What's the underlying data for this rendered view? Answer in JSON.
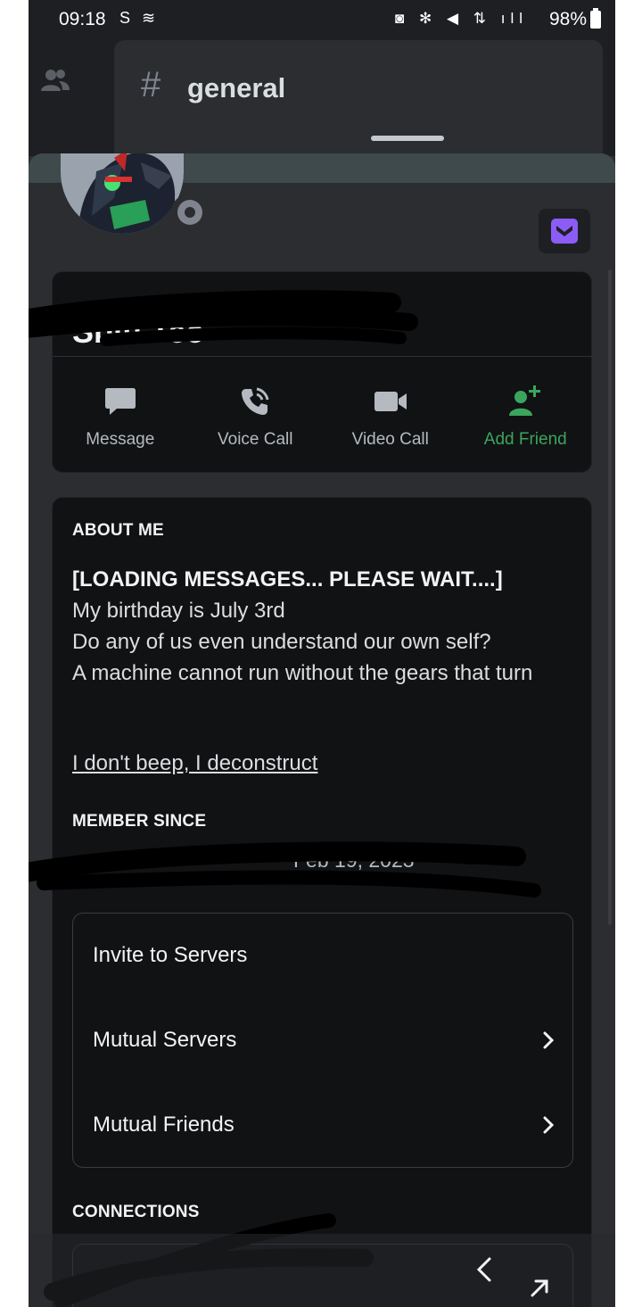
{
  "status_bar": {
    "time": "09:18",
    "left_icons": "S ≋",
    "right_icons": "◙ ✻ ◀ ⇅ ıll",
    "battery": "98%"
  },
  "channel": {
    "hash": "#",
    "name": "general"
  },
  "profile": {
    "display_name": "Sbitl Tec",
    "status": "offline",
    "actions": [
      {
        "label": "Message",
        "icon": "message-icon"
      },
      {
        "label": "Voice Call",
        "icon": "phone-icon"
      },
      {
        "label": "Video Call",
        "icon": "video-icon"
      },
      {
        "label": "Add Friend",
        "icon": "add-friend-icon"
      }
    ]
  },
  "about": {
    "title": "ABOUT ME",
    "headline": "[LOADING MESSAGES... PLEASE WAIT....]",
    "lines": [
      "My birthday is July 3rd",
      "Do any of us even understand our own self?",
      "A machine cannot run without the gears that turn"
    ],
    "link": "I don't beep, I deconstruct"
  },
  "member_since": {
    "title": "MEMBER SINCE",
    "date": "Feb 19, 2023"
  },
  "menu": {
    "invite": "Invite to Servers",
    "mutual_servers": "Mutual Servers",
    "mutual_friends": "Mutual Friends"
  },
  "connections": {
    "title": "CONNECTIONS"
  },
  "colors": {
    "background": "#2b2d31",
    "card": "#111214",
    "accent_green": "#3ba55d",
    "nitro": "#8c5cf6"
  }
}
